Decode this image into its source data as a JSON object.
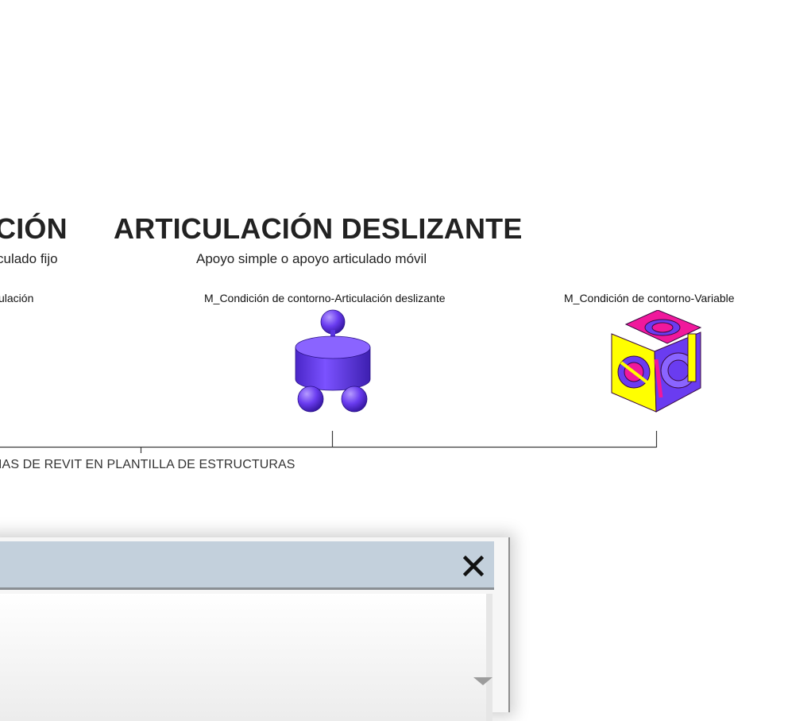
{
  "sections": {
    "left": {
      "title": "CIÓN",
      "subtitle": "culado fijo",
      "family_name": "ulación"
    },
    "center": {
      "title": "ARTICULACIÓN DESLIZANTE",
      "subtitle": "Apoyo simple o apoyo articulado móvil",
      "family_name": "M_Condición de contorno-Articulación deslizante"
    },
    "right": {
      "family_name": "M_Condición de contorno-Variable"
    }
  },
  "caption": "IAS DE REVIT EN PLANTILLA DE ESTRUCTURAS",
  "icons": {
    "sliding_support": "sliding-support-3d-icon",
    "variable_support": "variable-support-cube-icon",
    "close": "close-icon",
    "dropdown": "chevron-down-icon"
  },
  "colors": {
    "support_purple": "#6a3cf0",
    "cube_magenta": "#f0189c",
    "cube_yellow": "#ffff00",
    "titlebar": "#c3d0dc"
  }
}
